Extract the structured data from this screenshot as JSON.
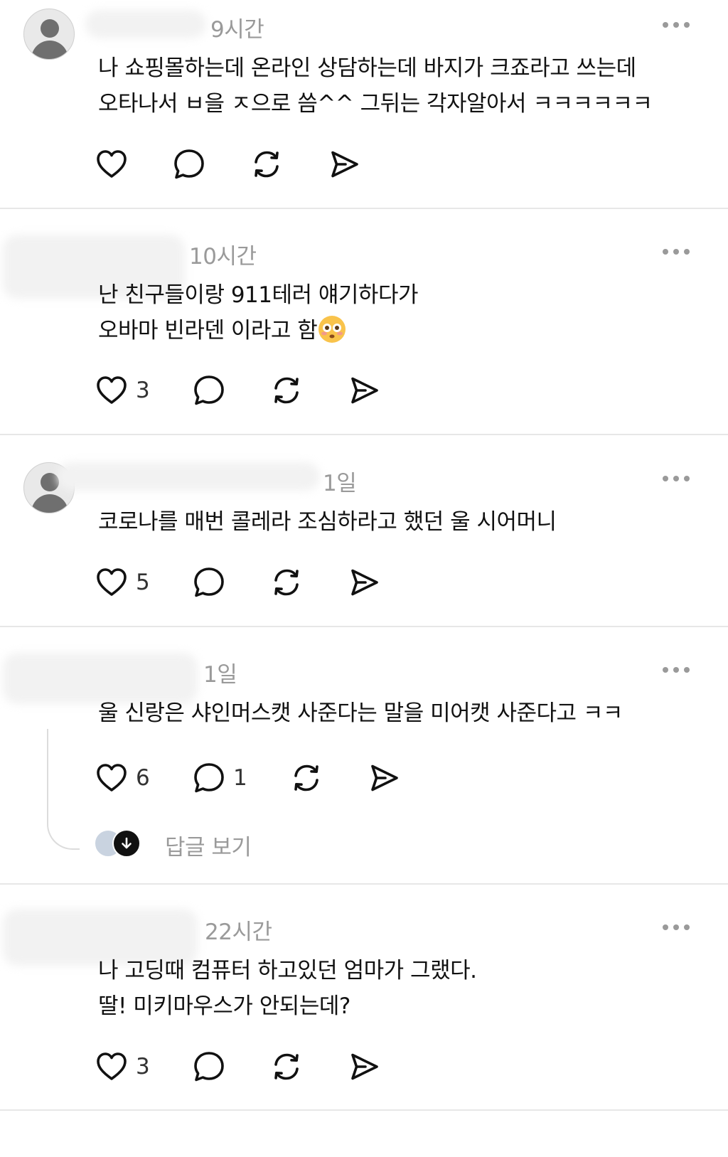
{
  "posts": [
    {
      "time": "9시간",
      "lines": [
        "나 쇼핑몰하는데 온라인 상담하는데 바지가 크죠라고 쓰는데",
        "오타나서 ㅂ을 ㅈ으로 씀^^ 그뒤는 각자알아서 ㅋㅋㅋㅋㅋㅋ"
      ],
      "likes": "",
      "replies": ""
    },
    {
      "time": "10시간",
      "lines": [
        "난 친구들이랑 911테러 얘기하다가",
        "오바마 빈라덴 이라고 함"
      ],
      "likes": "3",
      "replies": ""
    },
    {
      "time": "1일",
      "lines": [
        "코로나를 매번 콜레라 조심하라고 했던 울 시어머니"
      ],
      "likes": "5",
      "replies": ""
    },
    {
      "time": "1일",
      "lines": [
        "울 신랑은 샤인머스캣 사준다는 말을 미어캣 사준다고 ㅋㅋ"
      ],
      "likes": "6",
      "replies": "1",
      "view_replies": "답글 보기"
    },
    {
      "time": "22시간",
      "lines": [
        "나 고딩때 컴퓨터 하고있던 엄마가 그랬다.",
        "딸! 미키마우스가 안되는데?"
      ],
      "likes": "3",
      "replies": ""
    }
  ],
  "icons": [
    "heart-icon",
    "comment-icon",
    "repost-icon",
    "share-icon",
    "more-icon",
    "flushed-face-emoji"
  ],
  "colors": {
    "meta": "#9a9a9a",
    "text": "#111111",
    "divider": "#e7e7e7"
  }
}
